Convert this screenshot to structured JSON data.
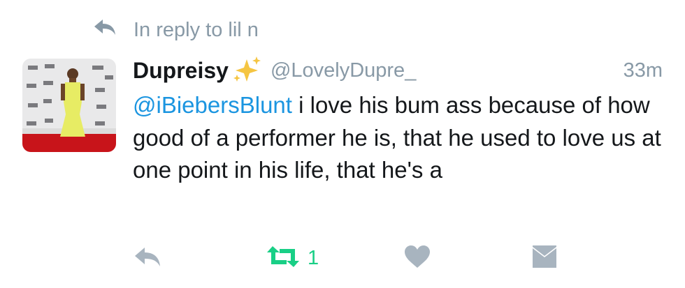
{
  "reply_context": {
    "text": "In reply to lil n",
    "icon": "reply-arrow-icon"
  },
  "tweet": {
    "author_name": "Dupreisy",
    "author_emoji": "sparkles",
    "handle": "@LovelyDupre_",
    "time": "33m",
    "mention": "@iBiebersBlunt",
    "text": " i love his bum ass because of how good of a performer he is, that he used to love us at one point in his life, that he's a"
  },
  "actions": {
    "retweet_count": "1",
    "icons": [
      "reply-icon",
      "retweet-icon",
      "like-icon",
      "direct-message-icon"
    ]
  },
  "colors": {
    "muted": "#8899a6",
    "text": "#14171a",
    "link": "#1b95e0",
    "retweet_active": "#19cf86",
    "icon_gray": "#a8b4bf"
  }
}
